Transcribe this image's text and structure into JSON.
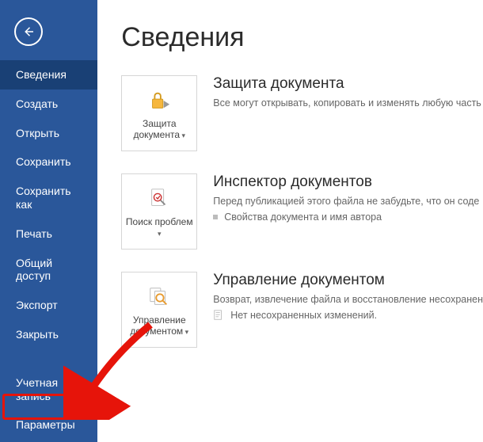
{
  "sidebar": {
    "items": [
      {
        "label": "Сведения",
        "active": true
      },
      {
        "label": "Создать"
      },
      {
        "label": "Открыть"
      },
      {
        "label": "Сохранить"
      },
      {
        "label": "Сохранить как"
      },
      {
        "label": "Печать"
      },
      {
        "label": "Общий доступ"
      },
      {
        "label": "Экспорт"
      },
      {
        "label": "Закрыть"
      }
    ],
    "footer": [
      {
        "label": "Учетная запись"
      },
      {
        "label": "Параметры",
        "highlighted": true
      }
    ]
  },
  "page": {
    "title": "Сведения"
  },
  "sections": [
    {
      "tileLabel": "Защита документа",
      "title": "Защита документа",
      "desc": "Все могут открывать, копировать и изменять любую часть",
      "icon": "lock"
    },
    {
      "tileLabel": "Поиск проблем",
      "title": "Инспектор документов",
      "desc": "Перед публикацией этого файла не забудьте, что он соде",
      "sub": "Свойства документа и имя автора",
      "subIcon": "bullet",
      "icon": "inspect"
    },
    {
      "tileLabel": "Управление документом",
      "title": "Управление документом",
      "desc": "Возврат, извлечение файла и восстановление несохранен",
      "sub": "Нет несохраненных изменений.",
      "subIcon": "doc",
      "icon": "manage"
    }
  ]
}
